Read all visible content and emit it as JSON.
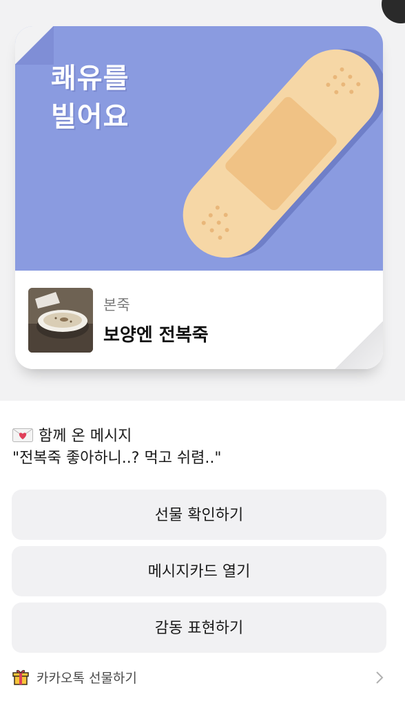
{
  "banner": {
    "headline_line1": "쾌유를",
    "headline_line2": "빌어요",
    "background_color": "#8a9be0",
    "illustration": "bandage-icon"
  },
  "product": {
    "brand": "본죽",
    "name": "보양엔 전복죽",
    "thumbnail": "porridge-bowl-image"
  },
  "message": {
    "icon": "envelope-heart-icon",
    "title": "함께 온 메시지",
    "body": "\"전복죽 좋아하니..? 먹고 쉬렴..\""
  },
  "buttons": {
    "check_gift": "선물 확인하기",
    "open_card": "메시지카드 열기",
    "express_thanks": "감동 표현하기"
  },
  "footer": {
    "label": "카카오톡 선물하기",
    "icon": "gift-box-icon"
  }
}
